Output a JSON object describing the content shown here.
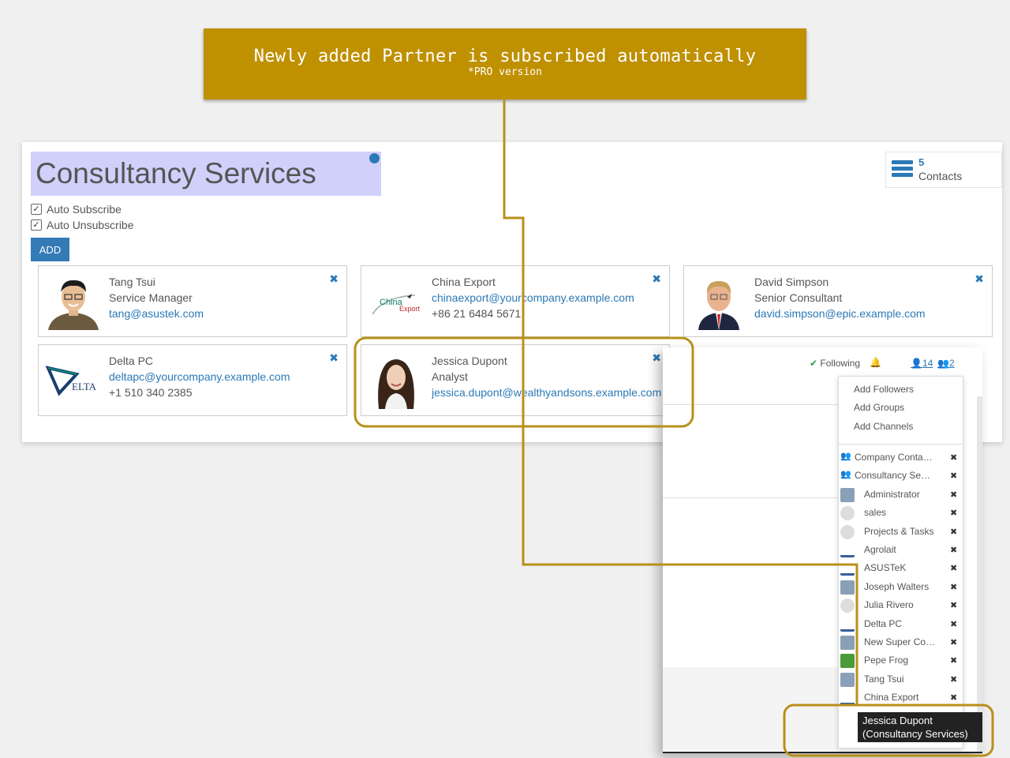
{
  "banner": {
    "title": "Newly added Partner is subscribed automatically",
    "subtitle": "*PRO version",
    "color": "#bf9000"
  },
  "form": {
    "title": "Consultancy Services",
    "checkboxes": [
      {
        "label": "Auto Subscribe",
        "checked": true
      },
      {
        "label": "Auto Unsubscribe",
        "checked": true
      }
    ],
    "add_label": "ADD",
    "stat": {
      "count": "5",
      "label": "Contacts"
    }
  },
  "cards": [
    {
      "name": "Tang Tsui",
      "line2": "Service Manager",
      "line3": "tang@asustek.com",
      "line2_is_link": false,
      "line3_is_link": true
    },
    {
      "name": "China Export",
      "line2": "chinaexport@yourcompany.example.com",
      "line3": "+86 21 6484 5671",
      "line2_is_link": true,
      "line3_is_link": false
    },
    {
      "name": "David Simpson",
      "line2": "Senior Consultant",
      "line3": "david.simpson@epic.example.com",
      "line2_is_link": false,
      "line3_is_link": true
    },
    {
      "name": "Delta PC",
      "line2": "deltapc@yourcompany.example.com",
      "line3": "+1 510 340 2385",
      "line2_is_link": true,
      "line3_is_link": false
    },
    {
      "name": "Jessica Dupont",
      "line2": "Analyst",
      "line3": "jessica.dupont@wealthyandsons.example.com",
      "line2_is_link": false,
      "line3_is_link": true
    }
  ],
  "china_logo_text": [
    "China",
    "Export"
  ],
  "delta_logo_text": "ELTA",
  "followers_panel": {
    "following_label": "Following",
    "followers_count": "14",
    "groups_count": "2",
    "actions": [
      "Add Followers",
      "Add Groups",
      "Add Channels"
    ],
    "followers": [
      {
        "name": "Company Contacts",
        "type": "group"
      },
      {
        "name": "Consultancy Services",
        "type": "group"
      },
      {
        "name": "Administrator",
        "type": "person"
      },
      {
        "name": "sales",
        "type": "placeholder"
      },
      {
        "name": "Projects & Tasks",
        "type": "placeholder"
      },
      {
        "name": "Agrolait",
        "type": "logo"
      },
      {
        "name": "ASUSTeK",
        "type": "logo"
      },
      {
        "name": "Joseph Walters",
        "type": "person"
      },
      {
        "name": "Julia Rivero",
        "type": "placeholder"
      },
      {
        "name": "Delta PC",
        "type": "logo"
      },
      {
        "name": "New Super Company",
        "type": "person"
      },
      {
        "name": "Pepe Frog",
        "type": "frog"
      },
      {
        "name": "Tang Tsui",
        "type": "person"
      },
      {
        "name": "China Export",
        "type": "logo"
      }
    ],
    "tooltip": [
      "Jessica Dupont",
      "(Consultancy Services)"
    ]
  },
  "colors": {
    "accent": "#2b79b6",
    "highlight": "#bf9000",
    "title_bg": "#d0d0fb"
  }
}
